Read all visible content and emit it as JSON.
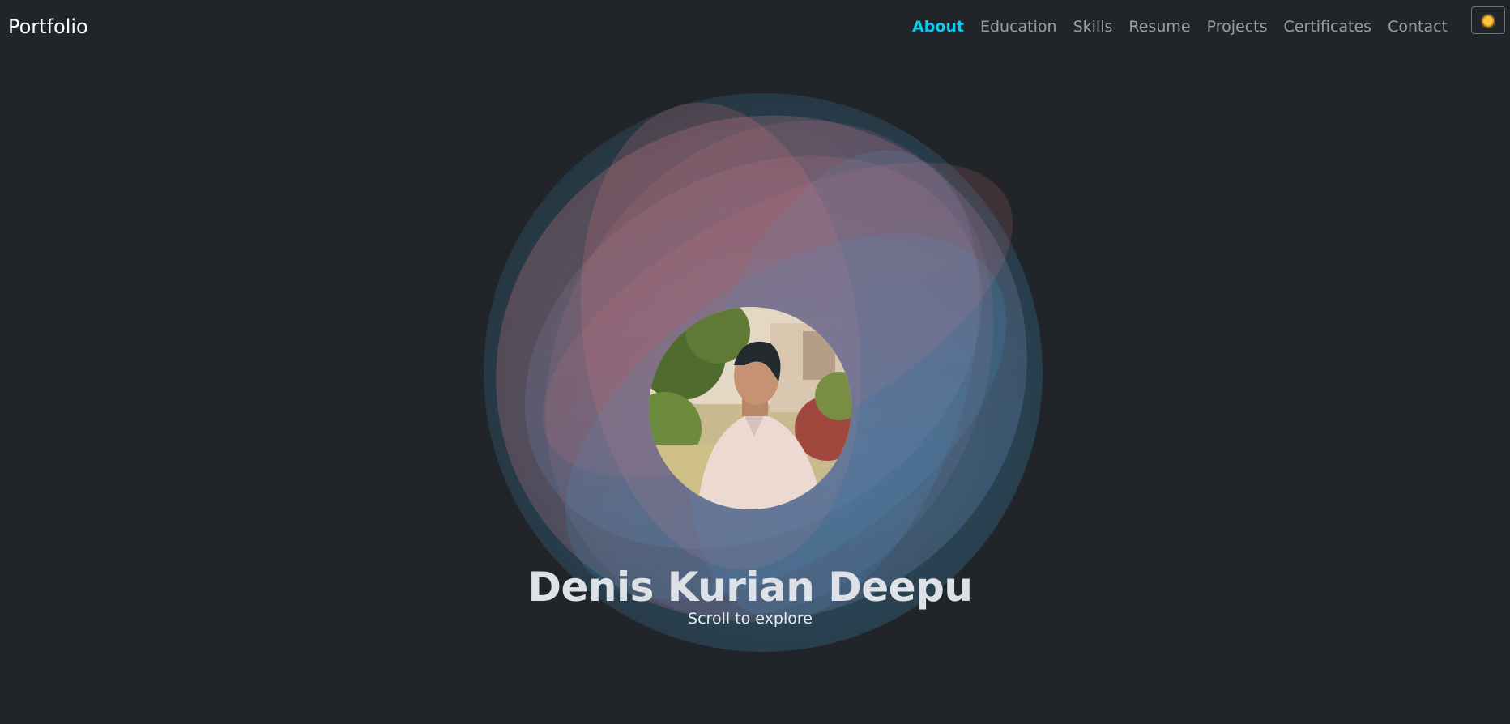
{
  "navbar": {
    "brand": "Portfolio",
    "links": [
      {
        "label": "About",
        "active": true
      },
      {
        "label": "Education",
        "active": false
      },
      {
        "label": "Skills",
        "active": false
      },
      {
        "label": "Resume",
        "active": false
      },
      {
        "label": "Projects",
        "active": false
      },
      {
        "label": "Certificates",
        "active": false
      },
      {
        "label": "Contact",
        "active": false
      }
    ],
    "theme_toggle_icon": "sun-icon"
  },
  "hero": {
    "name": "Denis Kurian Deepu",
    "subtitle": "Scroll to explore"
  },
  "colors": {
    "background": "#212529",
    "accent": "#0dcaf0",
    "blob_pink": "#d4767a",
    "blob_blue": "#3f8fbf"
  }
}
